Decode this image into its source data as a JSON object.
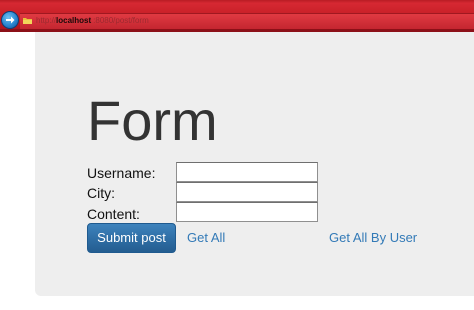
{
  "browser": {
    "url_prefix": "http://",
    "url_host": "localhost",
    "url_path": ":8080/post/form"
  },
  "page": {
    "title": "Form"
  },
  "form": {
    "fields": [
      {
        "label": "Username:",
        "value": ""
      },
      {
        "label": "City:",
        "value": ""
      },
      {
        "label": "Content:",
        "value": ""
      }
    ],
    "submit_label": "Submit post"
  },
  "links": {
    "get_all": "Get All",
    "get_all_by_user": "Get All By User"
  },
  "colors": {
    "browser_bar": "#c82028",
    "container_bg": "#eeeeee",
    "primary_button": "#2e6da4",
    "link": "#337ab7",
    "title_text": "#333333"
  }
}
